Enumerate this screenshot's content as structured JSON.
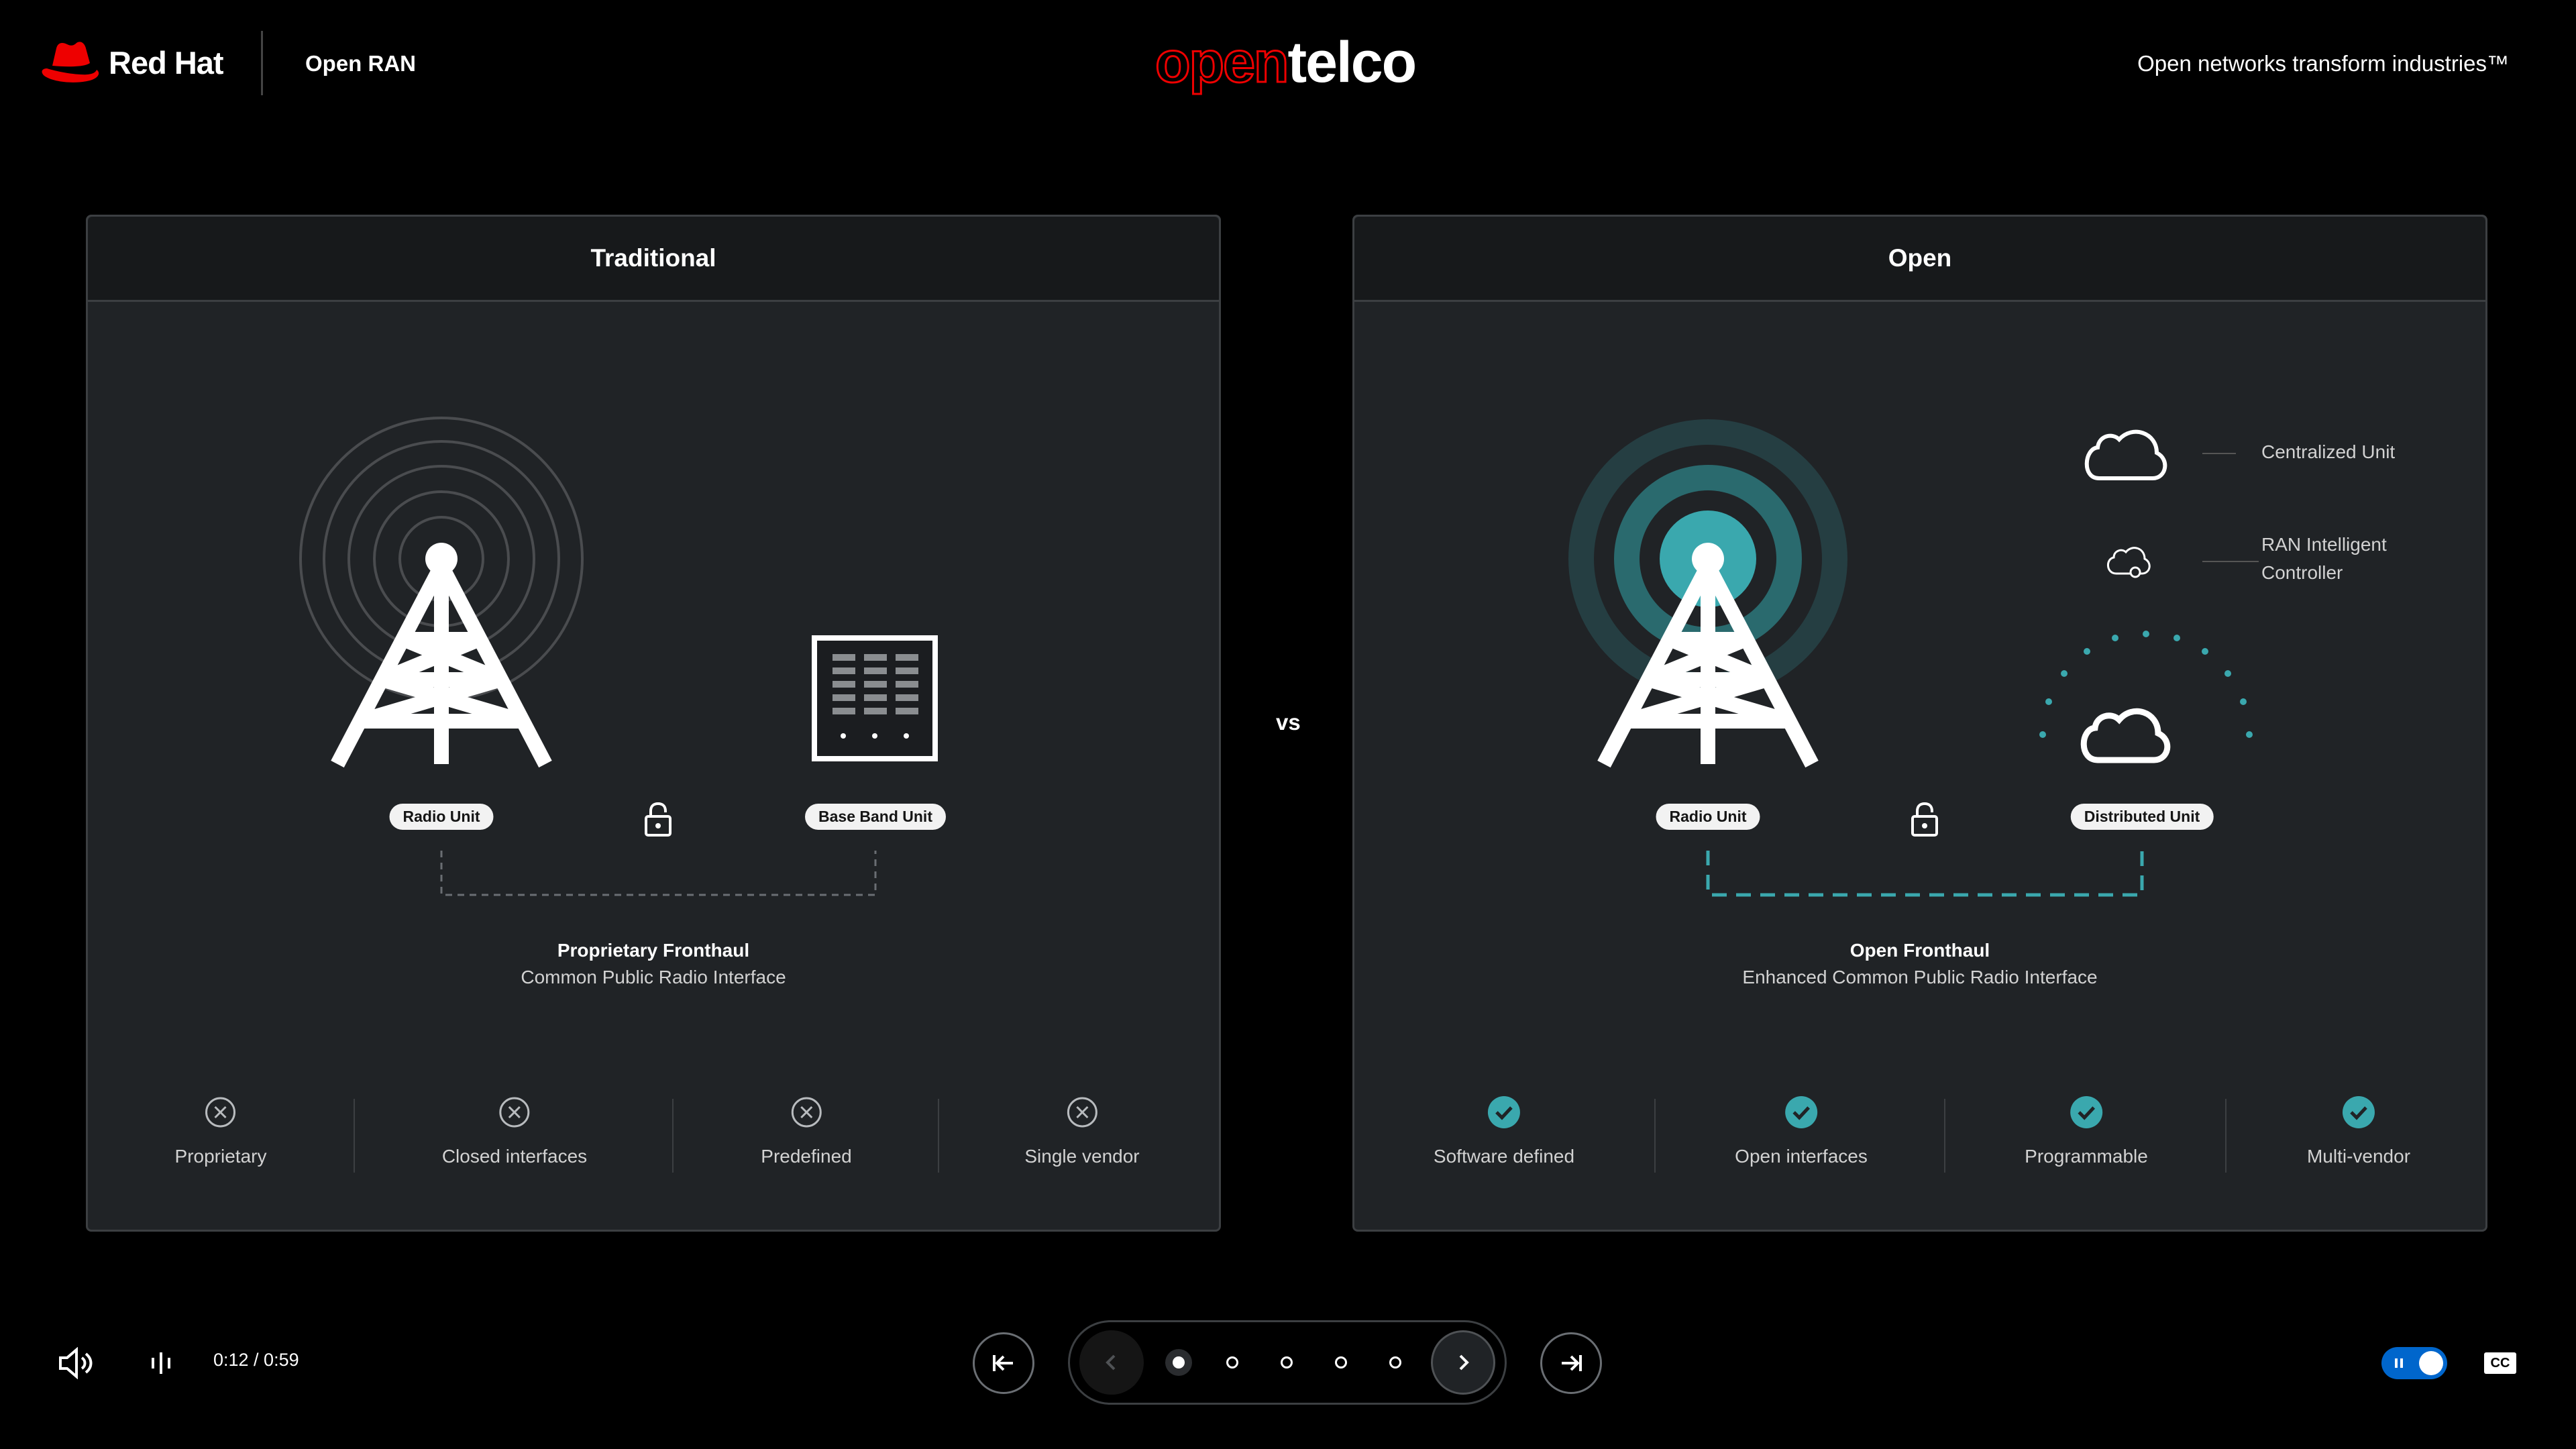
{
  "header": {
    "brand": "Red Hat",
    "product": "Open RAN",
    "logo_open": "open",
    "logo_telco": "telco",
    "tagline": "Open networks transform industries™",
    "brand_color": "#ee0000"
  },
  "vs_label": "vs",
  "traditional": {
    "title": "Traditional",
    "radio_unit": "Radio Unit",
    "base_band_unit": "Base Band Unit",
    "fronthaul_title": "Proprietary Fronthaul",
    "fronthaul_sub": "Common Public Radio Interface",
    "features": [
      "Proprietary",
      "Closed interfaces",
      "Predefined",
      "Single vendor"
    ],
    "feature_icon": "x-circle-icon"
  },
  "open": {
    "title": "Open",
    "radio_unit": "Radio Unit",
    "distributed_unit": "Distributed Unit",
    "centralized_unit": "Centralized Unit",
    "ric_line1": "RAN Intelligent",
    "ric_line2": "Controller",
    "fronthaul_title": "Open Fronthaul",
    "fronthaul_sub": "Enhanced Common Public Radio Interface",
    "features": [
      "Software defined",
      "Open interfaces",
      "Programmable",
      "Multi-vendor"
    ],
    "feature_icon": "check-circle-icon",
    "accent_color": "#3aa8ae"
  },
  "player": {
    "time": "0:12 / 0:59",
    "current_slide": 1,
    "total_slides": 5,
    "cc_label": "CC",
    "toggle_on": true,
    "toggle_color": "#0066cc"
  }
}
